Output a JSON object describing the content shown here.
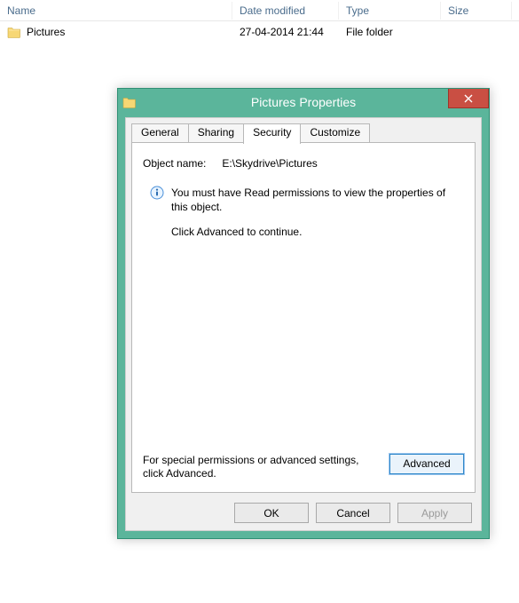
{
  "explorer": {
    "columns": {
      "name": "Name",
      "date": "Date modified",
      "type": "Type",
      "size": "Size"
    },
    "rows": [
      {
        "icon": "folder-icon",
        "name": "Pictures",
        "date": "27-04-2014 21:44",
        "type": "File folder",
        "size": ""
      }
    ]
  },
  "dialog": {
    "title": "Pictures Properties",
    "tabs": {
      "general": "General",
      "sharing": "Sharing",
      "security": "Security",
      "customize": "Customize"
    },
    "active_tab": "security",
    "object_name_label": "Object name:",
    "object_name_value": "E:\\Skydrive\\Pictures",
    "info_line1": "You must have Read permissions to view the properties of this object.",
    "info_line2": "Click Advanced to continue.",
    "bottom_hint": "For special permissions or advanced settings, click Advanced.",
    "advanced_label": "Advanced",
    "ok_label": "OK",
    "cancel_label": "Cancel",
    "apply_label": "Apply"
  }
}
